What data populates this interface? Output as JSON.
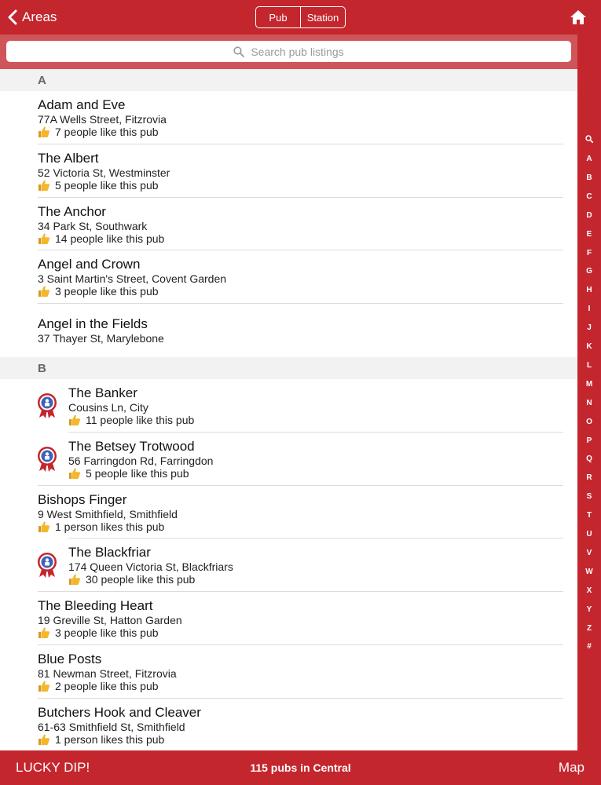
{
  "navbar": {
    "back_label": "Areas",
    "segments": [
      "Pub",
      "Station"
    ],
    "home_icon": "home-icon"
  },
  "search": {
    "placeholder": "Search pub listings"
  },
  "index": [
    "A",
    "B",
    "C",
    "D",
    "E",
    "F",
    "G",
    "H",
    "I",
    "J",
    "K",
    "L",
    "M",
    "N",
    "O",
    "P",
    "Q",
    "R",
    "S",
    "T",
    "U",
    "V",
    "W",
    "X",
    "Y",
    "Z",
    "#"
  ],
  "sections": [
    {
      "letter": "A",
      "pubs": [
        {
          "name": "Adam and Eve",
          "address": "77A Wells Street, Fitzrovia",
          "likes": "7 people like this pub",
          "badge": false
        },
        {
          "name": "The Albert",
          "address": "52 Victoria St, Westminster",
          "likes": "5 people like this pub",
          "badge": false
        },
        {
          "name": "The Anchor",
          "address": "34 Park St, Southwark",
          "likes": "14 people like this pub",
          "badge": false
        },
        {
          "name": "Angel and Crown",
          "address": "3 Saint Martin's Street, Covent Garden",
          "likes": "3 people like this pub",
          "badge": false
        },
        {
          "name": "Angel in the Fields",
          "address": "37 Thayer St, Marylebone",
          "likes": null,
          "badge": false
        }
      ]
    },
    {
      "letter": "B",
      "pubs": [
        {
          "name": "The Banker",
          "address": "Cousins Ln, City",
          "likes": "11 people like this pub",
          "badge": true
        },
        {
          "name": "The Betsey Trotwood",
          "address": "56 Farringdon Rd, Farringdon",
          "likes": "5 people like this pub",
          "badge": true
        },
        {
          "name": "Bishops Finger",
          "address": "9 West Smithfield, Smithfield",
          "likes": "1 person likes this pub",
          "badge": false
        },
        {
          "name": "The Blackfriar",
          "address": "174 Queen Victoria St, Blackfriars",
          "likes": "30 people like this pub",
          "badge": true
        },
        {
          "name": "The Bleeding Heart",
          "address": "19 Greville St, Hatton Garden",
          "likes": "3 people like this pub",
          "badge": false
        },
        {
          "name": "Blue Posts",
          "address": "81 Newman Street, Fitzrovia",
          "likes": "2 people like this pub",
          "badge": false
        },
        {
          "name": "Butchers Hook and Cleaver",
          "address": "61-63 Smithfield St, Smithfield",
          "likes": "1 person likes this pub",
          "badge": false
        }
      ]
    }
  ],
  "bottombar": {
    "lucky_label": "LUCKY DIP!",
    "count_label": "115 pubs in Central",
    "map_label": "Map"
  },
  "colors": {
    "brand_red": "#c4262e",
    "search_band": "#d0555a",
    "section_bg": "#f2f2f2",
    "thumb": "#f0b429"
  }
}
